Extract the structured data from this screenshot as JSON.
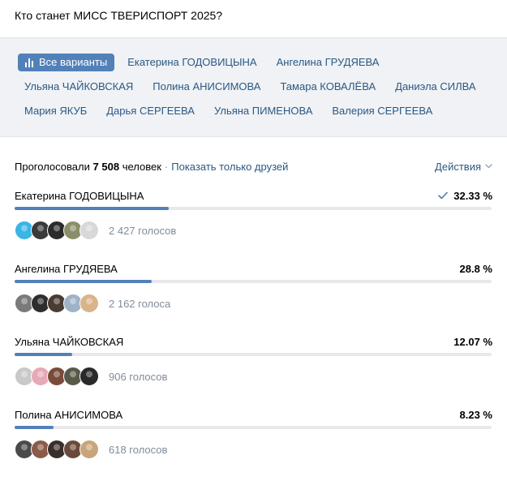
{
  "question": "Кто станет МИСС ТВЕРИСПОРТ 2025?",
  "filters": [
    [
      "Все варианты",
      "Екатерина ГОДОВИЦЫНА",
      "Ангелина ГРУДЯЕВА"
    ],
    [
      "Ульяна ЧАЙКОВСКАЯ",
      "Полина АНИСИМОВА",
      "Тамара КОВАЛЁВА",
      "Даниэла СИЛВА"
    ],
    [
      "Мария ЯКУБ",
      "Дарья СЕРГЕЕВА",
      "Ульяна ПИМЕНОВА",
      "Валерия СЕРГЕЕВА"
    ]
  ],
  "summary": {
    "voted_prefix": "Проголосовали",
    "voted_count": "7 508",
    "voted_suffix": "человек",
    "separator": "·",
    "friends_link": "Показать только друзей",
    "actions": "Действия"
  },
  "options": [
    {
      "name": "Екатерина ГОДОВИЦЫНА",
      "percent": "32.33 %",
      "share": 32.33,
      "votes": "2 427 голосов",
      "checked": true,
      "avatar_colors": [
        "#3bb4e6",
        "#3a3a3a",
        "#2b2b2b",
        "#8a8f6a",
        "#d8d8d8"
      ]
    },
    {
      "name": "Ангелина ГРУДЯЕВА",
      "percent": "28.8 %",
      "share": 28.8,
      "votes": "2 162 голоса",
      "checked": false,
      "avatar_colors": [
        "#7a7a7a",
        "#2e2e2e",
        "#4a3b33",
        "#9fb3c8",
        "#d9b48a"
      ]
    },
    {
      "name": "Ульяна ЧАЙКОВСКАЯ",
      "percent": "12.07 %",
      "share": 12.07,
      "votes": "906 голосов",
      "checked": false,
      "avatar_colors": [
        "#c9c9c9",
        "#e6a9b5",
        "#7a4b3a",
        "#5a5a4a",
        "#2a2a2a"
      ]
    },
    {
      "name": "Полина АНИСИМОВА",
      "percent": "8.23 %",
      "share": 8.23,
      "votes": "618 голосов",
      "checked": false,
      "avatar_colors": [
        "#4a4a4a",
        "#8a5a4a",
        "#3a2e2a",
        "#6a4a3a",
        "#c9a57a"
      ]
    }
  ],
  "colors": {
    "accent": "#5181b8",
    "link": "#2a5885",
    "muted": "#818c99",
    "check": "#4a7aa8"
  }
}
